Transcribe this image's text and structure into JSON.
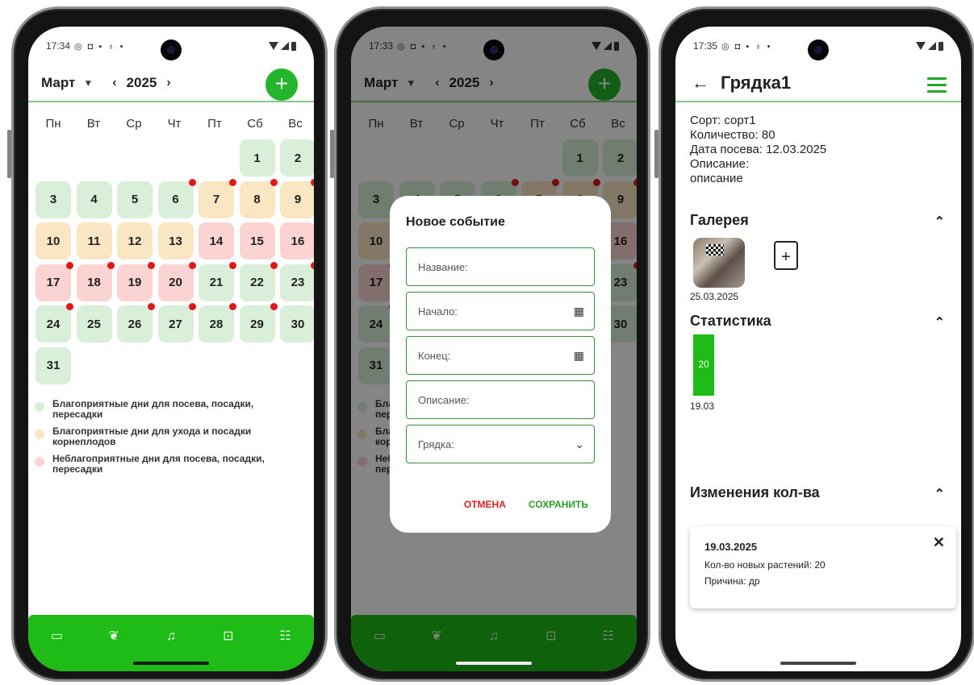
{
  "status": {
    "time1": "17:34",
    "time2": "17:33",
    "time3": "17:35",
    "icons": "◎ ◘ ▪ ♁ •"
  },
  "calendar": {
    "month": "Март",
    "year": "2025",
    "add_label": "+",
    "weekdays": [
      "Пн",
      "Вт",
      "Ср",
      "Чт",
      "Пт",
      "Сб",
      "Вс"
    ],
    "start_offset": 5,
    "days": [
      {
        "d": "1",
        "t": "fav",
        "dot": false
      },
      {
        "d": "2",
        "t": "fav",
        "dot": false
      },
      {
        "d": "3",
        "t": "fav",
        "dot": false
      },
      {
        "d": "4",
        "t": "fav",
        "dot": false
      },
      {
        "d": "5",
        "t": "fav",
        "dot": false
      },
      {
        "d": "6",
        "t": "fav",
        "dot": true
      },
      {
        "d": "7",
        "t": "care",
        "dot": true
      },
      {
        "d": "8",
        "t": "care",
        "dot": true
      },
      {
        "d": "9",
        "t": "care",
        "dot": true
      },
      {
        "d": "10",
        "t": "care",
        "dot": false
      },
      {
        "d": "11",
        "t": "care",
        "dot": false
      },
      {
        "d": "12",
        "t": "care",
        "dot": false
      },
      {
        "d": "13",
        "t": "care",
        "dot": false
      },
      {
        "d": "14",
        "t": "bad",
        "dot": false
      },
      {
        "d": "15",
        "t": "bad",
        "dot": false
      },
      {
        "d": "16",
        "t": "bad",
        "dot": false
      },
      {
        "d": "17",
        "t": "bad",
        "dot": true
      },
      {
        "d": "18",
        "t": "bad",
        "dot": true
      },
      {
        "d": "19",
        "t": "bad",
        "dot": true
      },
      {
        "d": "20",
        "t": "bad",
        "dot": true
      },
      {
        "d": "21",
        "t": "fav",
        "dot": true
      },
      {
        "d": "22",
        "t": "fav",
        "dot": true
      },
      {
        "d": "23",
        "t": "fav",
        "dot": true
      },
      {
        "d": "24",
        "t": "fav",
        "dot": true
      },
      {
        "d": "25",
        "t": "fav",
        "dot": false
      },
      {
        "d": "26",
        "t": "fav",
        "dot": true
      },
      {
        "d": "27",
        "t": "fav",
        "dot": true
      },
      {
        "d": "28",
        "t": "fav",
        "dot": true
      },
      {
        "d": "29",
        "t": "fav",
        "dot": true
      },
      {
        "d": "30",
        "t": "fav",
        "dot": false
      },
      {
        "d": "31",
        "t": "fav",
        "dot": false
      }
    ],
    "legend": [
      {
        "color": "#d9efd9",
        "text": "Благоприятные дни для посева, посадки, пересадки"
      },
      {
        "color": "#fbe6c4",
        "text": "Благоприятные дни для ухода и посадки корнеплодов"
      },
      {
        "color": "#fbd3d3",
        "text": "Неблагоприятные дни для посева, посадки, пересадки"
      }
    ]
  },
  "bottom_nav": [
    {
      "name": "calendar-icon",
      "glyph": "▭"
    },
    {
      "name": "plant-icon",
      "glyph": "❦"
    },
    {
      "name": "bell-icon",
      "glyph": "♫"
    },
    {
      "name": "download-box-icon",
      "glyph": "⊡"
    },
    {
      "name": "people-icon",
      "glyph": "☷"
    }
  ],
  "dialog": {
    "title": "Новое событие",
    "name_label": "Название:",
    "start_label": "Начало:",
    "end_label": "Конец:",
    "desc_label": "Описание:",
    "bed_label": "Грядка:",
    "cancel": "ОТМЕНА",
    "save": "СОХРАНИТЬ"
  },
  "bed": {
    "title": "Грядка1",
    "variety": "Сорт: сорт1",
    "quantity": "Количество: 80",
    "sow_date": "Дата посева: 12.03.2025",
    "desc_label": "Описание:",
    "desc_value": "описание",
    "gallery_title": "Галерея",
    "photo_date": "25.03.2025",
    "stats_title": "Статистика",
    "changes_title": "Изменения кол-ва",
    "change_card": {
      "date": "19.03.2025",
      "new_plants": "Кол-во новых растений: 20",
      "reason": "Причина: др"
    }
  },
  "chart_data": {
    "type": "bar",
    "categories": [
      "19.03"
    ],
    "values": [
      20
    ],
    "title": "Статистика",
    "xlabel": "",
    "ylabel": "",
    "ylim": [
      0,
      20
    ]
  }
}
